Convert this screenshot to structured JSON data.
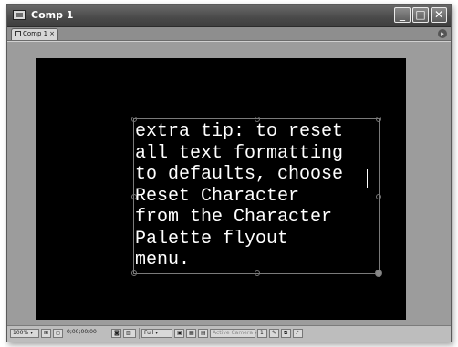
{
  "window": {
    "title": "Comp 1",
    "controls": {
      "minimize": "_",
      "maximize": "□",
      "close": "✕"
    }
  },
  "tabs": [
    {
      "label": "Comp 1",
      "close": "×"
    }
  ],
  "panel": {
    "flyout_icon": "▸"
  },
  "viewer": {
    "canvas_color": "#000000",
    "text_lines": [
      "extra tip: to reset",
      "all text formatting",
      "to defaults, choose",
      "Reset Character",
      "from the Character",
      "Palette flyout",
      "menu."
    ]
  },
  "footer": {
    "zoom": "100%",
    "safe_margins_icon": "grid-icon",
    "snapshot_icon": "camera-icon",
    "timecode": "0;00;00;00",
    "resolution": "Full",
    "camera_view": "Active Camera",
    "view_layout": "1"
  }
}
